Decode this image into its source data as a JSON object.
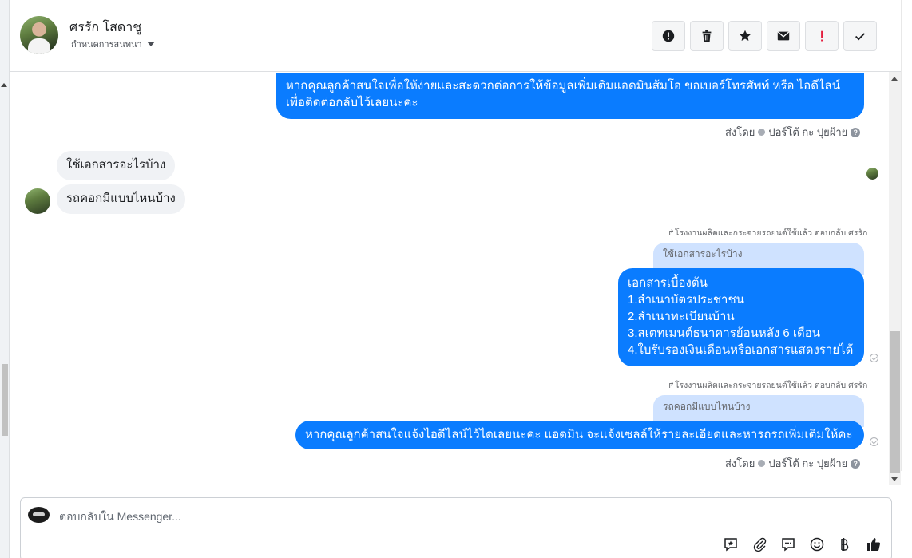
{
  "header": {
    "name": "ศรรัก โสดาชู",
    "sub_label": "กำหนดการสนทนา"
  },
  "messages": {
    "m1": {
      "lines": [
        "หากคุณลูกค้าสนใจเพื่อให้ง่ายและสะดวกต่อการให้ข้อมูลเพิ่มเติมแอดมินส้มโอ ขอเบอร์โทรศัพท์ หรือ ไอดีไลน์",
        "เพื่อติดต่อกลับไว้เลยนะคะ"
      ]
    },
    "sent_by_1": {
      "prefix": "ส่งโดย",
      "author": "ปอร์โต้ กะ ปุยฝ้าย",
      "help": "?"
    },
    "in1": "ใช้เอกสารอะไรบ้าง",
    "in2": "รถคอกมีแบบไหนบ้าง",
    "reply_note_1": "โรงงานผลิตและกระจายรถยนต์ใช้แล้ว ตอบกลับ ศรรัก",
    "quote1": "ใช้เอกสารอะไรบ้าง",
    "m2": {
      "lines": [
        "เอกสารเบื้องต้น",
        "1.สำเนาบัตรประชาชน",
        "2.สำเนาทะเบียนบ้าน",
        "3.สเตทเมนต์ธนาคารย้อนหลัง 6 เดือน",
        "4.ใบรับรองเงินเดือนหรือเอกสารแสดงรายได้"
      ]
    },
    "reply_note_2": "โรงงานผลิตและกระจายรถยนต์ใช้แล้ว ตอบกลับ ศรรัก",
    "quote2": "รถคอกมีแบบไหนบ้าง",
    "m3": "หากคุณลูกค้าสนใจแจ้งไอดีไลน์ไว้ไดเลยนะคะ แอดมิน จะแจ้งเซลล์ให้รายละเอียดและหารถรถเพิ่มเติมให้คะ",
    "sent_by_2": {
      "prefix": "ส่งโดย",
      "author": "ปอร์โต้ กะ ปุยฝ้าย",
      "help": "?"
    }
  },
  "composer": {
    "placeholder": "ตอบกลับใน Messenger..."
  },
  "toolbar_icons": [
    "alert-circle-icon",
    "trash-icon",
    "star-icon",
    "envelope-icon",
    "exclamation-icon",
    "check-icon"
  ],
  "composer_icons": [
    "saved-reply-icon",
    "attachment-icon",
    "chat-bubble-icon",
    "emoji-icon",
    "baht-icon",
    "thumbs-up-icon"
  ],
  "colors": {
    "outgoing_bubble": "#0a7cff",
    "incoming_bubble": "#f0f2f5",
    "quote_bubble": "#cfe2ff",
    "exclamation": "#e41e3f",
    "like": "#1c1e21"
  }
}
